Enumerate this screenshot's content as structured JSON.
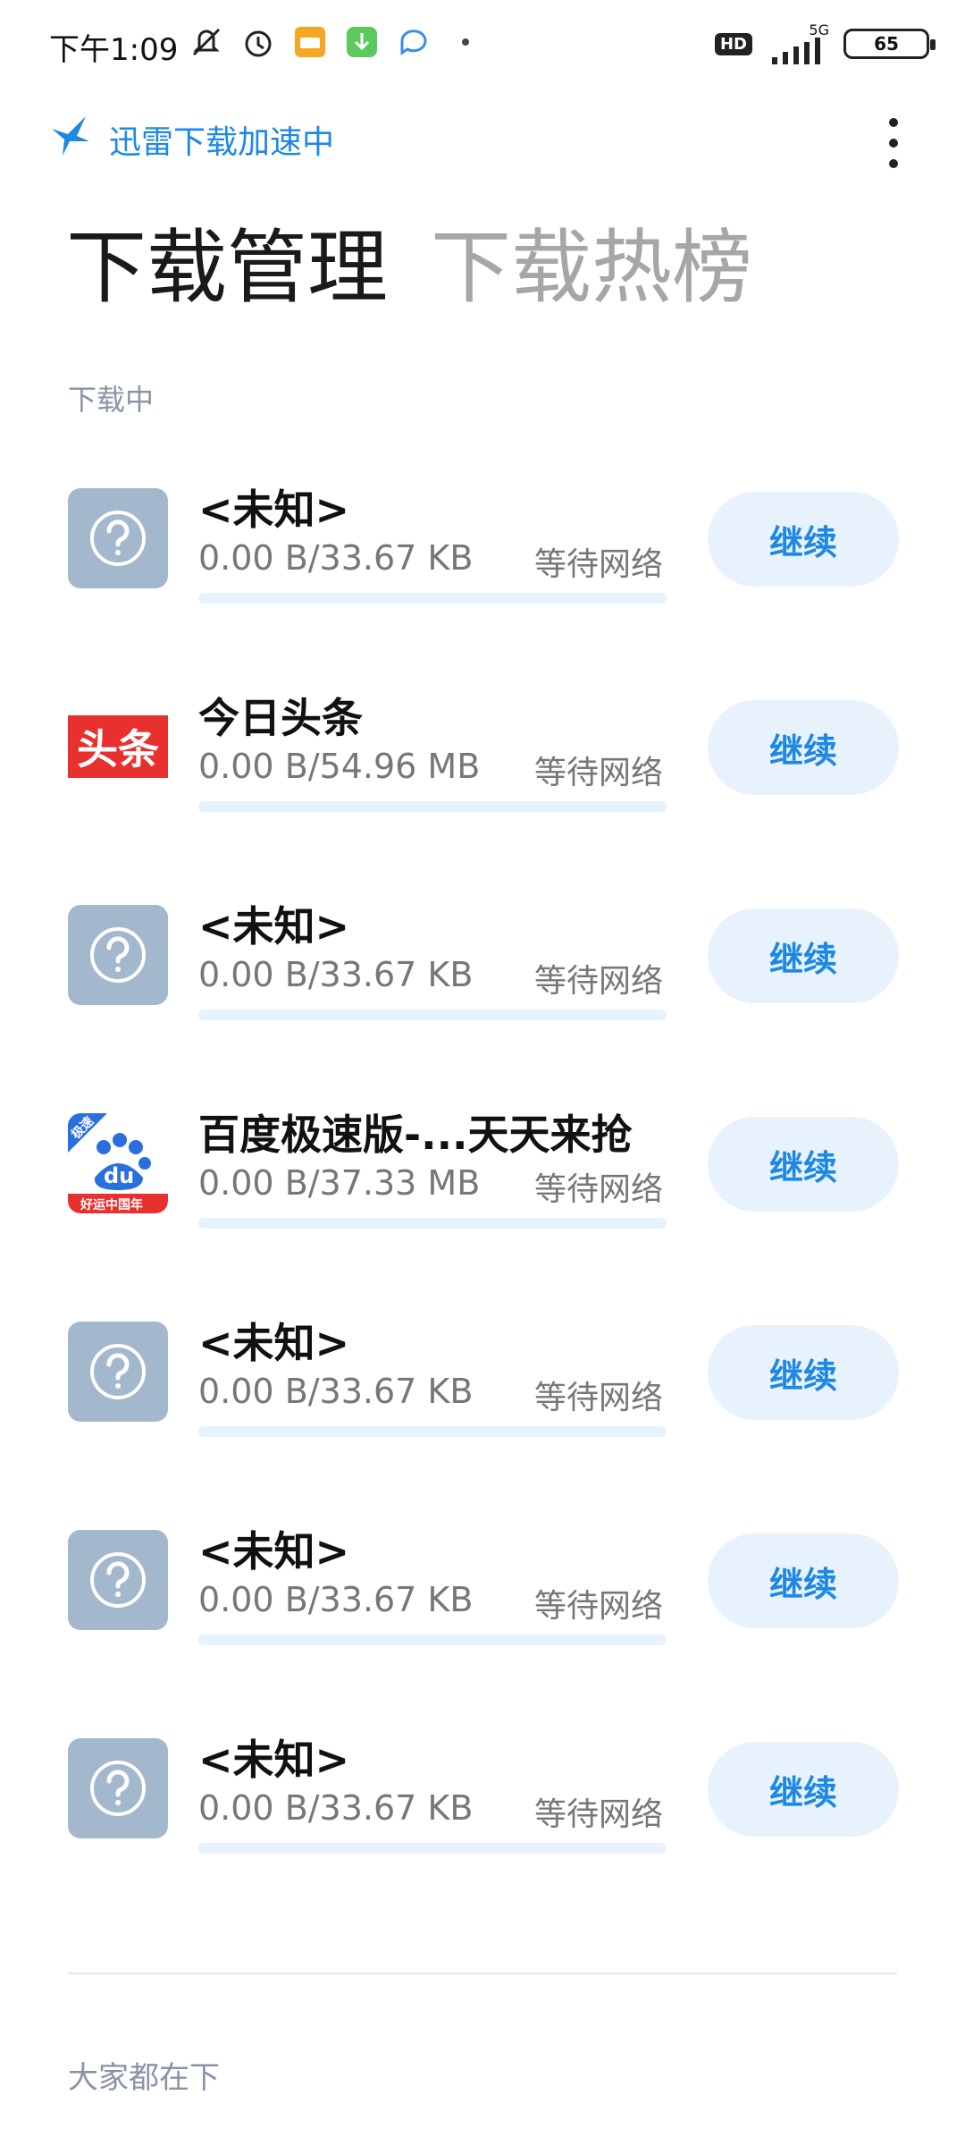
{
  "status_bar": {
    "time": "下午1:09",
    "network": "5G",
    "hd": "HD",
    "battery": "65"
  },
  "header": {
    "brand_text": "迅雷下载加速中"
  },
  "tabs": [
    {
      "label": "下载管理",
      "active": true
    },
    {
      "label": "下载热榜",
      "active": false
    }
  ],
  "section_label": "下载中",
  "downloads": [
    {
      "icon": "unknown-app-icon",
      "title": "<未知>",
      "size": "0.00 B/33.67 KB",
      "status": "等待网络",
      "progress": 0,
      "button": "继续"
    },
    {
      "icon": "toutiao-app-icon",
      "title": "今日头条",
      "size": "0.00 B/54.96 MB",
      "status": "等待网络",
      "progress": 0,
      "button": "继续",
      "icon_text": "头条"
    },
    {
      "icon": "unknown-app-icon",
      "title": "<未知>",
      "size": "0.00 B/33.67 KB",
      "status": "等待网络",
      "progress": 0,
      "button": "继续"
    },
    {
      "icon": "baidu-app-icon",
      "title": "百度极速版-...天天来抢",
      "size": "0.00 B/37.33 MB",
      "status": "等待网络",
      "progress": 0,
      "button": "继续",
      "icon_text": "du",
      "icon_badge": "极速",
      "icon_banner": "好运中国年"
    },
    {
      "icon": "unknown-app-icon",
      "title": "<未知>",
      "size": "0.00 B/33.67 KB",
      "status": "等待网络",
      "progress": 0,
      "button": "继续"
    },
    {
      "icon": "unknown-app-icon",
      "title": "<未知>",
      "size": "0.00 B/33.67 KB",
      "status": "等待网络",
      "progress": 0,
      "button": "继续"
    },
    {
      "icon": "unknown-app-icon",
      "title": "<未知>",
      "size": "0.00 B/33.67 KB",
      "status": "等待网络",
      "progress": 0,
      "button": "继续"
    }
  ],
  "footer_label": "大家都在下",
  "colors": {
    "accent": "#1e88e5",
    "button_bg": "#e7f2fc",
    "unknown_icon_bg": "#a3b8cc",
    "toutiao_red": "#e8312f"
  }
}
